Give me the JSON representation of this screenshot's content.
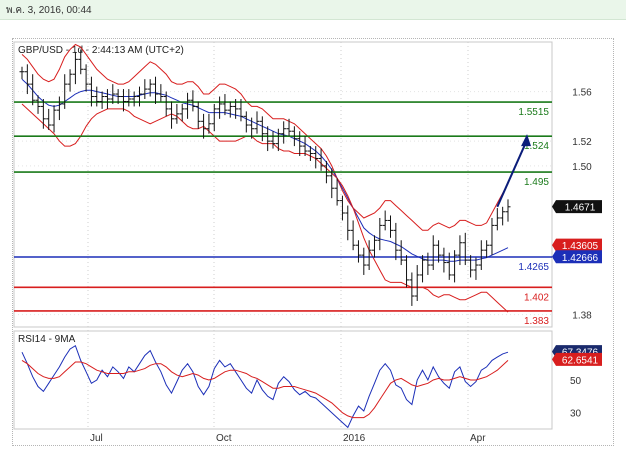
{
  "window": {
    "timestamp": "พ.ค. 3, 2016, 00:44"
  },
  "chart_data": [
    {
      "type": "line",
      "title": "GBP/USD - 1d - 2:44:13 AM (UTC+2)",
      "ylim": [
        1.37,
        1.6
      ],
      "y_ticks": [
        "1.56",
        "1.52",
        "1.50",
        "1.38"
      ],
      "x_ticks": [
        "Jul",
        "Oct",
        "2016",
        "Apr"
      ],
      "series": [
        {
          "name": "",
          "values": [
            1.576,
            1.566,
            1.553,
            1.548,
            1.538,
            1.533,
            1.545,
            1.55,
            1.566,
            1.574,
            1.586,
            1.578,
            1.566,
            1.556,
            1.552,
            1.556,
            1.554,
            1.558,
            1.556,
            1.552,
            1.554,
            1.556,
            1.558,
            1.562,
            1.566,
            1.558,
            1.556,
            1.546,
            1.538,
            1.542,
            1.546,
            1.553,
            1.548,
            1.536,
            1.53,
            1.534,
            1.546,
            1.55,
            1.545,
            1.548,
            1.546,
            1.54,
            1.533,
            1.53,
            1.536,
            1.526,
            1.52,
            1.518,
            1.526,
            1.53,
            1.528,
            1.522,
            1.516,
            1.512,
            1.51,
            1.506,
            1.5,
            1.492,
            1.482,
            1.472,
            1.462,
            1.448,
            1.436,
            1.428,
            1.42,
            1.432,
            1.44,
            1.452,
            1.456,
            1.448,
            1.432,
            1.424,
            1.408,
            1.395,
            1.412,
            1.424,
            1.42,
            1.436,
            1.428,
            1.422,
            1.412,
            1.428,
            1.438,
            1.424,
            1.416,
            1.42,
            1.432,
            1.436,
            1.452,
            1.458,
            1.463,
            1.467
          ]
        }
      ],
      "bollinger": [
        {
          "name": "upper",
          "values": [
            1.59,
            1.586,
            1.58,
            1.574,
            1.57,
            1.568,
            1.57,
            1.578,
            1.588,
            1.594,
            1.598,
            1.596,
            1.59,
            1.584,
            1.578,
            1.574,
            1.57,
            1.568,
            1.566,
            1.566,
            1.568,
            1.572,
            1.576,
            1.58,
            1.584,
            1.582,
            1.578,
            1.574,
            1.568,
            1.566,
            1.566,
            1.568,
            1.568,
            1.564,
            1.558,
            1.558,
            1.562,
            1.566,
            1.566,
            1.564,
            1.562,
            1.558,
            1.552,
            1.548,
            1.548,
            1.546,
            1.542,
            1.538,
            1.538,
            1.538,
            1.536,
            1.534,
            1.53,
            1.526,
            1.522,
            1.518,
            1.514,
            1.508,
            1.5,
            1.49,
            1.48,
            1.472,
            1.466,
            1.462,
            1.458,
            1.46,
            1.462,
            1.466,
            1.472,
            1.472,
            1.468,
            1.464,
            1.46,
            1.456,
            1.452,
            1.448,
            1.448,
            1.452,
            1.454,
            1.452,
            1.45,
            1.452,
            1.456,
            1.456,
            1.454,
            1.452,
            1.452,
            1.454,
            1.462,
            1.47,
            1.478,
            1.486
          ]
        },
        {
          "name": "middle",
          "values": [
            1.57,
            1.566,
            1.561,
            1.556,
            1.552,
            1.549,
            1.548,
            1.549,
            1.552,
            1.555,
            1.558,
            1.56,
            1.561,
            1.561,
            1.56,
            1.559,
            1.558,
            1.557,
            1.556,
            1.556,
            1.556,
            1.556,
            1.557,
            1.558,
            1.559,
            1.559,
            1.558,
            1.557,
            1.555,
            1.553,
            1.551,
            1.55,
            1.549,
            1.547,
            1.545,
            1.543,
            1.543,
            1.543,
            1.543,
            1.542,
            1.541,
            1.54,
            1.538,
            1.536,
            1.534,
            1.532,
            1.53,
            1.528,
            1.526,
            1.525,
            1.524,
            1.522,
            1.52,
            1.518,
            1.515,
            1.512,
            1.508,
            1.503,
            1.497,
            1.49,
            1.482,
            1.474,
            1.466,
            1.458,
            1.45,
            1.446,
            1.443,
            1.441,
            1.44,
            1.439,
            1.437,
            1.435,
            1.432,
            1.429,
            1.427,
            1.425,
            1.424,
            1.424,
            1.424,
            1.424,
            1.423,
            1.423,
            1.424,
            1.424,
            1.424,
            1.424,
            1.425,
            1.426,
            1.428,
            1.43,
            1.432,
            1.434
          ]
        },
        {
          "name": "lower",
          "values": [
            1.55,
            1.546,
            1.542,
            1.538,
            1.534,
            1.53,
            1.526,
            1.52,
            1.516,
            1.516,
            1.518,
            1.524,
            1.532,
            1.538,
            1.542,
            1.544,
            1.546,
            1.546,
            1.546,
            1.546,
            1.544,
            1.54,
            1.538,
            1.536,
            1.534,
            1.536,
            1.538,
            1.54,
            1.542,
            1.54,
            1.536,
            1.532,
            1.53,
            1.53,
            1.532,
            1.528,
            1.524,
            1.52,
            1.52,
            1.52,
            1.52,
            1.522,
            1.524,
            1.524,
            1.52,
            1.518,
            1.518,
            1.518,
            1.514,
            1.512,
            1.512,
            1.51,
            1.51,
            1.51,
            1.508,
            1.506,
            1.502,
            1.498,
            1.494,
            1.49,
            1.484,
            1.476,
            1.466,
            1.454,
            1.442,
            1.432,
            1.424,
            1.416,
            1.408,
            1.406,
            1.406,
            1.406,
            1.404,
            1.402,
            1.402,
            1.402,
            1.4,
            1.396,
            1.394,
            1.396,
            1.396,
            1.394,
            1.392,
            1.392,
            1.394,
            1.396,
            1.398,
            1.398,
            1.394,
            1.39,
            1.386,
            1.382
          ]
        }
      ],
      "horizontal_levels": [
        {
          "label": "1.5515",
          "value": 1.5515,
          "color": "#1a7a1a"
        },
        {
          "label": "1.524",
          "value": 1.524,
          "color": "#1a7a1a"
        },
        {
          "label": "1.495",
          "value": 1.495,
          "color": "#1a7a1a"
        },
        {
          "label": "1.4265",
          "value": 1.4265,
          "color": "#1c2fb8"
        },
        {
          "label": "1.402",
          "value": 1.402,
          "color": "#d81e1e"
        },
        {
          "label": "1.383",
          "value": 1.383,
          "color": "#d81e1e"
        }
      ],
      "price_tags": [
        {
          "label": "1.4671",
          "value": 1.4671,
          "bg": "#111111"
        },
        {
          "label": "1.43605",
          "value": 1.43605,
          "bg": "#d81e1e"
        },
        {
          "label": "1.42666",
          "value": 1.42666,
          "bg": "#1c2fb8"
        }
      ],
      "arrow": {
        "from": [
          89,
          1.467
        ],
        "to": [
          94,
          1.524
        ],
        "color": "#0b1d7a"
      }
    },
    {
      "type": "line",
      "title": "RSI14 - 9MA",
      "ylim": [
        20,
        80
      ],
      "y_ticks": [
        "50",
        "30"
      ],
      "series": [
        {
          "name": "",
          "values": [
            67,
            60,
            52,
            46,
            43,
            48,
            53,
            58,
            64,
            69,
            71,
            62,
            55,
            48,
            50,
            56,
            52,
            58,
            55,
            51,
            58,
            55,
            60,
            65,
            68,
            61,
            55,
            47,
            42,
            49,
            56,
            60,
            55,
            46,
            41,
            46,
            57,
            62,
            58,
            60,
            55,
            50,
            45,
            42,
            50,
            44,
            40,
            38,
            48,
            52,
            49,
            44,
            41,
            43,
            40,
            39,
            36,
            33,
            30,
            27,
            24,
            21,
            28,
            34,
            31,
            40,
            48,
            56,
            60,
            56,
            47,
            45,
            38,
            35,
            50,
            56,
            50,
            58,
            52,
            48,
            45,
            55,
            58,
            49,
            46,
            49,
            56,
            58,
            62,
            64,
            66,
            67
          ]
        },
        {
          "name": "",
          "values": [
            62,
            60,
            57,
            54,
            52,
            51,
            51,
            52,
            55,
            58,
            61,
            61,
            60,
            58,
            56,
            55,
            54,
            54,
            54,
            54,
            55,
            55,
            56,
            57,
            59,
            60,
            60,
            58,
            55,
            53,
            52,
            53,
            54,
            53,
            51,
            50,
            51,
            53,
            55,
            56,
            56,
            55,
            54,
            52,
            51,
            49,
            47,
            45,
            45,
            46,
            46,
            46,
            45,
            44,
            43,
            42,
            40,
            38,
            36,
            33,
            30,
            28,
            27,
            27,
            27,
            29,
            33,
            38,
            43,
            48,
            50,
            51,
            49,
            47,
            46,
            47,
            48,
            50,
            51,
            50,
            50,
            51,
            52,
            51,
            50,
            50,
            51,
            52,
            54,
            56,
            59,
            62
          ]
        }
      ],
      "price_tags": [
        {
          "label": "67.3476",
          "value": 67.3476,
          "bg": "#1a2a6c"
        },
        {
          "label": "62.6541",
          "value": 62.6541,
          "bg": "#d81e1e"
        }
      ]
    }
  ]
}
